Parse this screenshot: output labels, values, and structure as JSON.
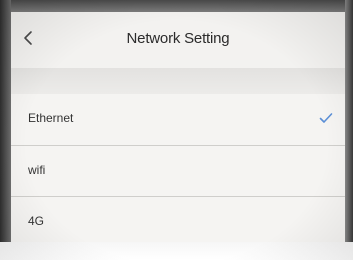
{
  "header": {
    "back_icon": "chevron-left-icon",
    "title": "Network Setting"
  },
  "network_options": [
    {
      "label": "Ethernet",
      "selected": true
    },
    {
      "label": "wifi",
      "selected": false
    },
    {
      "label": "4G",
      "selected": false
    }
  ],
  "colors": {
    "check_accent": "#5b8fd6"
  }
}
